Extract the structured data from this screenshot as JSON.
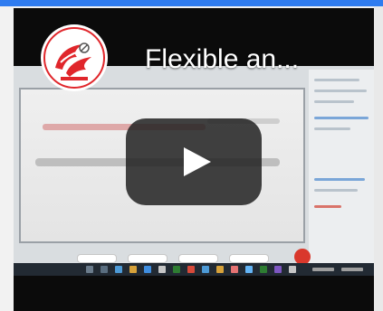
{
  "video": {
    "title": "Flexible an..."
  },
  "colors": {
    "top_bar": "#2f7cf0",
    "play_button_bg": "#212121",
    "play_icon": "#ffffff",
    "logo_red": "#e0262b"
  },
  "icons": {
    "play": "play-icon",
    "logo": "channel-logo-icon"
  }
}
